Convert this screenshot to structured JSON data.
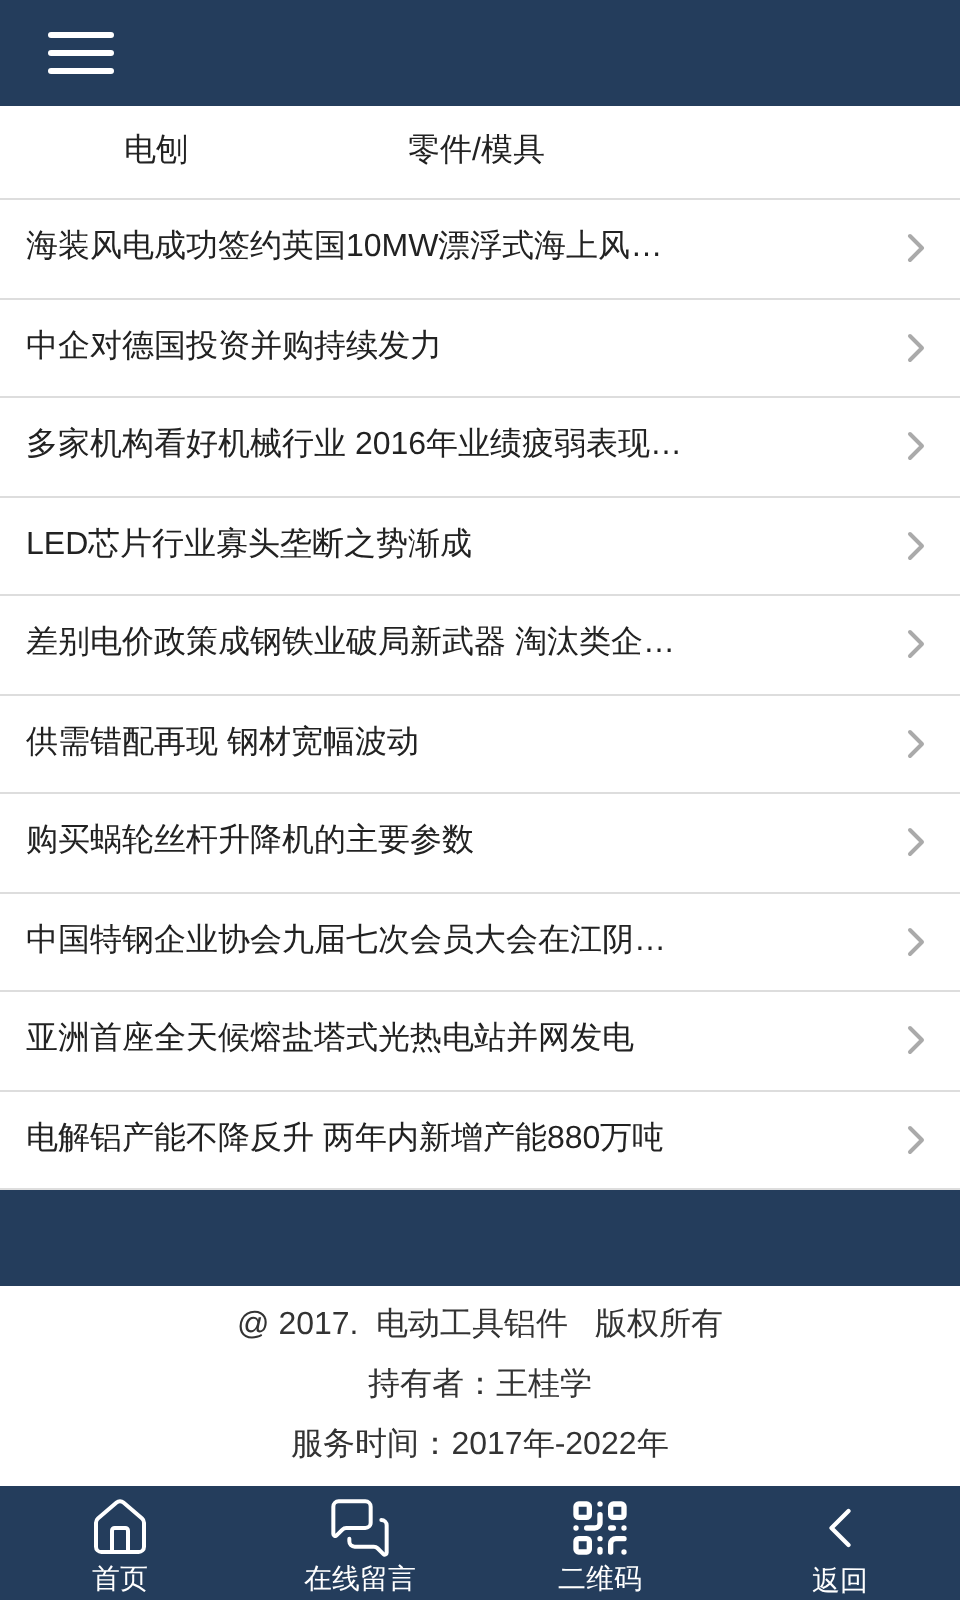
{
  "tabs": [
    {
      "label": "电刨"
    },
    {
      "label": "零件/模具"
    }
  ],
  "articles": [
    {
      "title": "海装风电成功签约英国10MW漂浮式海上风…"
    },
    {
      "title": "中企对德国投资并购持续发力"
    },
    {
      "title": "多家机构看好机械行业 2016年业绩疲弱表现…"
    },
    {
      "title": "LED芯片行业寡头垄断之势渐成"
    },
    {
      "title": "差别电价政策成钢铁业破局新武器 淘汰类企…"
    },
    {
      "title": "供需错配再现 钢材宽幅波动"
    },
    {
      "title": "购买蜗轮丝杆升降机的主要参数"
    },
    {
      "title": "中国特钢企业协会九届七次会员大会在江阴…"
    },
    {
      "title": "亚洲首座全天候熔盐塔式光热电站并网发电"
    },
    {
      "title": "电解铝产能不降反升 两年内新增产能880万吨"
    }
  ],
  "footer": {
    "copyright": "@ 2017.  电动工具铝件   版权所有",
    "owner": "持有者：王桂学",
    "service_time": "服务时间：2017年-2022年"
  },
  "bottom_nav": [
    {
      "kind": "home",
      "label": "首页"
    },
    {
      "kind": "chat",
      "label": "在线留言"
    },
    {
      "kind": "qr",
      "label": "二维码"
    },
    {
      "kind": "back",
      "label": "返回"
    }
  ]
}
